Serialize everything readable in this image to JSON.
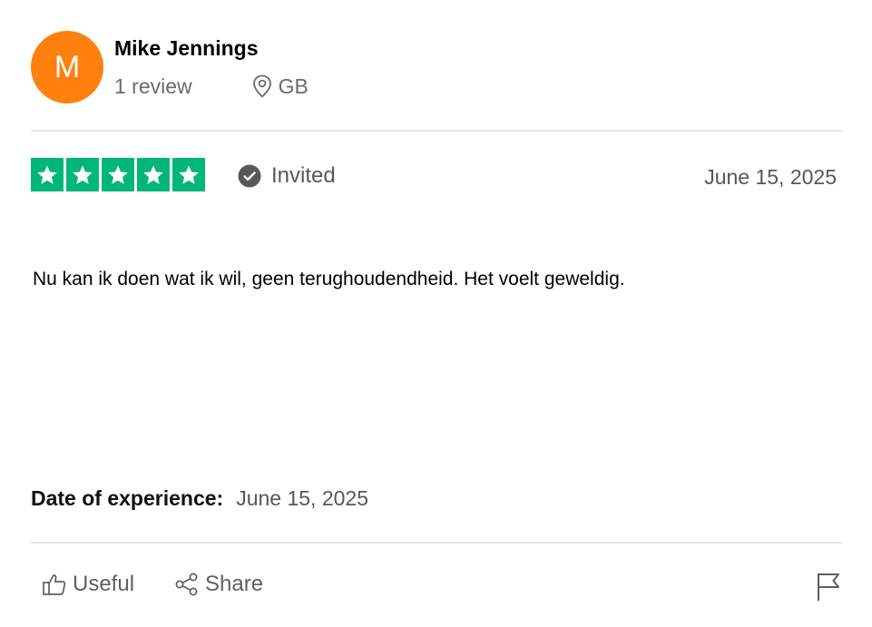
{
  "reviewer": {
    "initial": "M",
    "name": "Mike Jennings",
    "review_count": "1 review",
    "country": "GB",
    "avatar_color": "#ff7f0f"
  },
  "review": {
    "rating": 5,
    "rating_color": "#00b67a",
    "invited_label": "Invited",
    "date": "June 15, 2025",
    "text": "Nu kan ik doen wat ik wil, geen terughoudendheid. Het voelt geweldig."
  },
  "experience": {
    "label": "Date of experience:",
    "date": "June 15, 2025"
  },
  "actions": {
    "useful_label": "Useful",
    "share_label": "Share"
  },
  "icons": {
    "location": "location-pin-icon",
    "invited": "check-circle-icon",
    "useful": "thumbs-up-icon",
    "share": "share-icon",
    "report": "flag-icon",
    "star": "star-icon"
  }
}
